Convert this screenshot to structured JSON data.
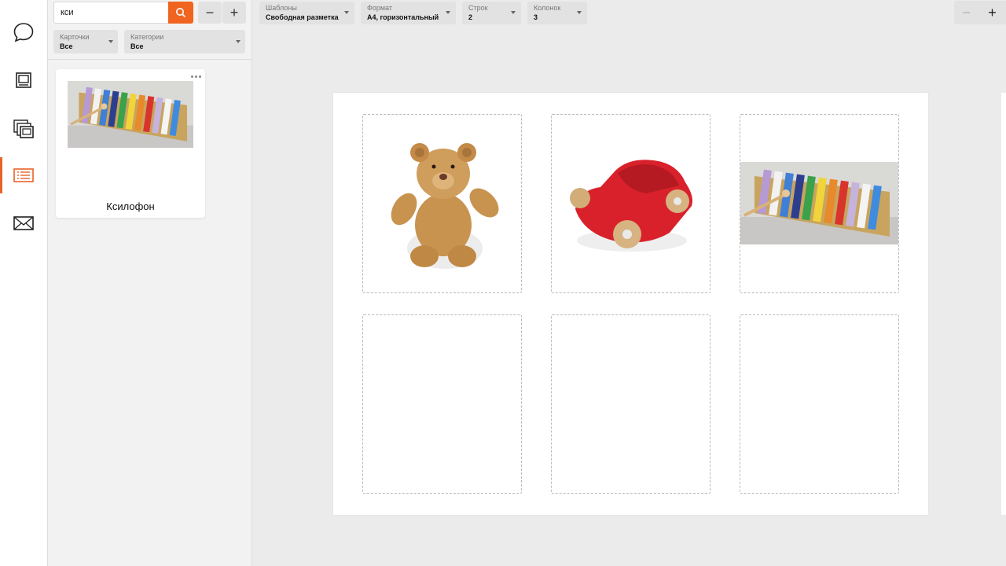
{
  "sidebar": {
    "items": [
      {
        "icon": "chat-icon"
      },
      {
        "icon": "monitor-icon"
      },
      {
        "icon": "gallery-icon"
      },
      {
        "icon": "list-icon",
        "active": true
      },
      {
        "icon": "mail-icon"
      }
    ]
  },
  "library": {
    "search": {
      "value": "кси",
      "placeholder": ""
    },
    "filters": {
      "cards": {
        "label": "Карточки",
        "value": "Все"
      },
      "categories": {
        "label": "Категории",
        "value": "Все"
      }
    },
    "results": [
      {
        "title": "Ксилофон",
        "image": "xylophone"
      }
    ]
  },
  "toolbar": {
    "templates": {
      "label": "Шаблоны",
      "value": "Свободная разметка"
    },
    "format": {
      "label": "Формат",
      "value": "А4, горизонтальный"
    },
    "rows": {
      "label": "Строк",
      "value": "2"
    },
    "columns": {
      "label": "Колонок",
      "value": "3"
    }
  },
  "page": {
    "cells": [
      {
        "content": "teddy-bear"
      },
      {
        "content": "toy-car"
      },
      {
        "content": "xylophone"
      },
      {
        "content": ""
      },
      {
        "content": ""
      },
      {
        "content": ""
      }
    ]
  },
  "colors": {
    "accent": "#f06420",
    "active_rail": "#e8632a"
  }
}
